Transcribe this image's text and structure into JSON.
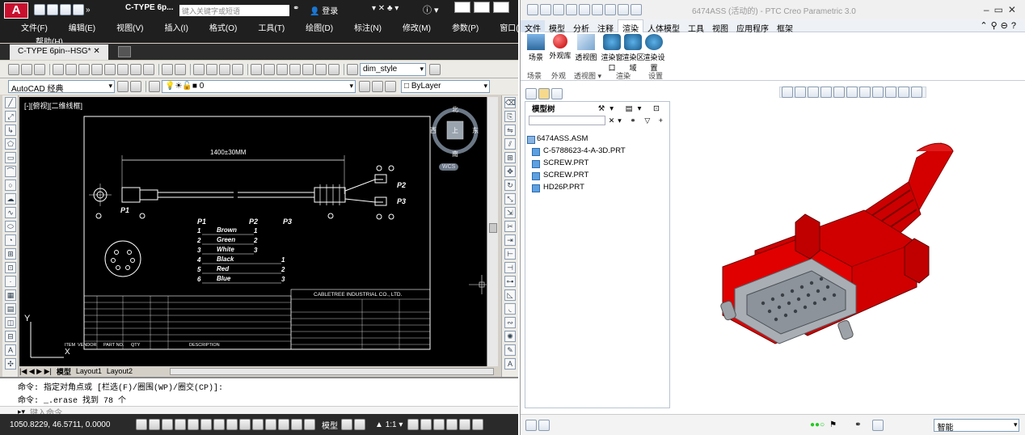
{
  "acad": {
    "logo": "A",
    "title": "C-TYPE 6p...",
    "search_placeholder": "键入关键字或短语",
    "login": "登录",
    "menu": [
      "文件(F)",
      "编辑(E)",
      "视图(V)",
      "插入(I)",
      "格式(O)",
      "工具(T)",
      "绘图(D)",
      "标注(N)",
      "修改(M)",
      "参数(P)",
      "窗口(W)"
    ],
    "help_menu": "帮助(H)",
    "doc_tab": "C-TYPE 6pin--HSG*",
    "dim_style": "dim_style",
    "workspace": "AutoCAD 经典",
    "layer": "0",
    "bylayer": "ByLayer",
    "viewport_label": "[-][俯视][二维线框]",
    "viewcube": {
      "n": "北",
      "s": "南",
      "e": "东",
      "w": "西",
      "top": "上",
      "wcs": "WCS"
    },
    "drawing": {
      "length": "1400±30MM",
      "p1": "P1",
      "p2": "P2",
      "p3": "P3",
      "wires": [
        {
          "num": "1",
          "name": "Brown",
          "end": "1"
        },
        {
          "num": "2",
          "name": "Green",
          "end": "2"
        },
        {
          "num": "3",
          "name": "White",
          "end": "3"
        },
        {
          "num": "4",
          "name": "Black",
          "end": "1"
        },
        {
          "num": "5",
          "name": "Red",
          "end": "2"
        },
        {
          "num": "6",
          "name": "Blue",
          "end": "3"
        }
      ],
      "company": "CABLETREE INDUSTRIAL CO., LTD.",
      "bom_header": [
        "ITEM",
        "VENDOR",
        "PART NO.",
        "QTY",
        "DESCRIPTION"
      ]
    },
    "layout_tabs": [
      "模型",
      "Layout1",
      "Layout2"
    ],
    "cmd_lines": [
      "命令: 指定对角点或 [栏选(F)/圈围(WP)/圈交(CP)]:",
      "命令: _.erase 找到 78 个"
    ],
    "cmd_placeholder": "键入命令",
    "coords": "1050.8229, 46.5711, 0.0000",
    "status_model": "模型",
    "scale": "1:1"
  },
  "creo": {
    "title": "6474ASS (活动的) - PTC Creo Parametric 3.0",
    "tabs": [
      "文件",
      "模型",
      "分析",
      "注释",
      "渲染",
      "人体模型",
      "工具",
      "视图",
      "应用程序",
      "框架"
    ],
    "active_tab": "渲染",
    "ribbon_buttons": [
      "场景",
      "外观库",
      "透视图",
      "渲染窗口",
      "渲染区域",
      "渲染设置"
    ],
    "groups": [
      "场景",
      "外观",
      "透视图",
      "渲染",
      "设置"
    ],
    "tree_title": "模型树",
    "tree_items": [
      "6474ASS.ASM",
      "C-5788623-4-A-3D.PRT",
      "SCREW.PRT",
      "SCREW.PRT",
      "HD26P.PRT"
    ],
    "status_filter": "智能"
  }
}
